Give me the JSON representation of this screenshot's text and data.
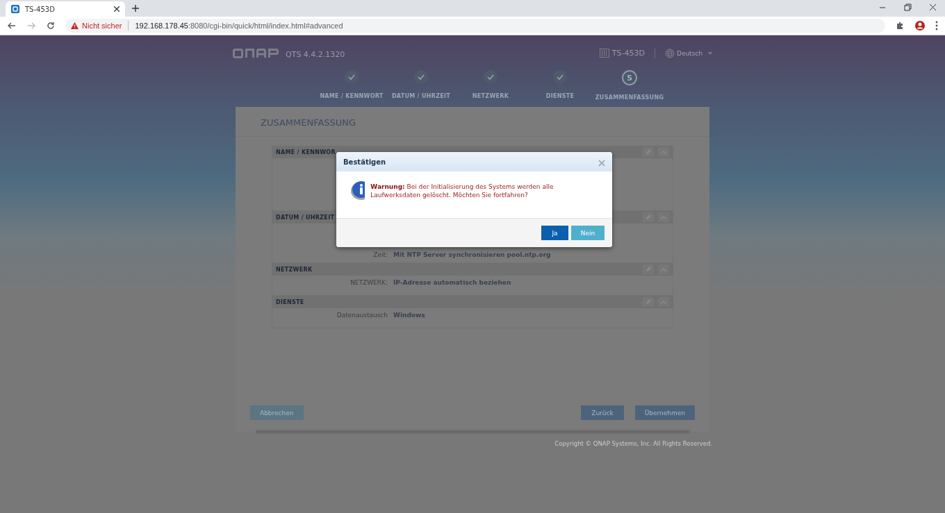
{
  "browser": {
    "tab": {
      "title": "TS-453D",
      "selected": true
    },
    "security": "Nicht sicher",
    "url_host": "192.168.178.45",
    "url_rest": ":8080/cgi-bin/quick/html/index.html#advanced"
  },
  "header": {
    "version": "QTS 4.4.2.1320",
    "device": "TS-453D",
    "language": "Deutsch"
  },
  "steps": [
    {
      "label": "NAME / KENNWORT",
      "done": true
    },
    {
      "label": "DATUM / UHRZEIT",
      "done": true
    },
    {
      "label": "NETZWERK",
      "done": true
    },
    {
      "label": "DIENSTE",
      "done": true
    },
    {
      "label": "ZUSAMMENFASSUNG",
      "done": false,
      "number": "5"
    }
  ],
  "summary": {
    "title": "ZUSAMMENFASSUNG",
    "sections": [
      {
        "title": "NAME / KENNWOR"
      },
      {
        "title": "DATUM / UHRZEIT",
        "rows": [
          {
            "label": "Zeit:",
            "value": "Mit NTP Server synchronisieren pool.ntp.org"
          }
        ]
      },
      {
        "title": "NETZWERK",
        "rows": [
          {
            "label": "NETZWERK:",
            "value": "IP-Adresse automatisch beziehen"
          }
        ]
      },
      {
        "title": "DIENSTE",
        "rows": [
          {
            "label": "Datenaustausch",
            "value": "Windows"
          }
        ]
      }
    ]
  },
  "buttons": {
    "cancel": "Abbrechen",
    "back": "Zurück",
    "apply": "Übernehmen"
  },
  "copyright": "Copyright © QNAP Systems, Inc. All Rights Reserved.",
  "dialog": {
    "title": "Bestätigen",
    "message": "**Warnung:** Bei der Initialisierung des Systems werden alle Laufwerksdaten gelöscht. Möchten Sie fortfahren?",
    "yes": "Ja",
    "no": "Nein"
  }
}
